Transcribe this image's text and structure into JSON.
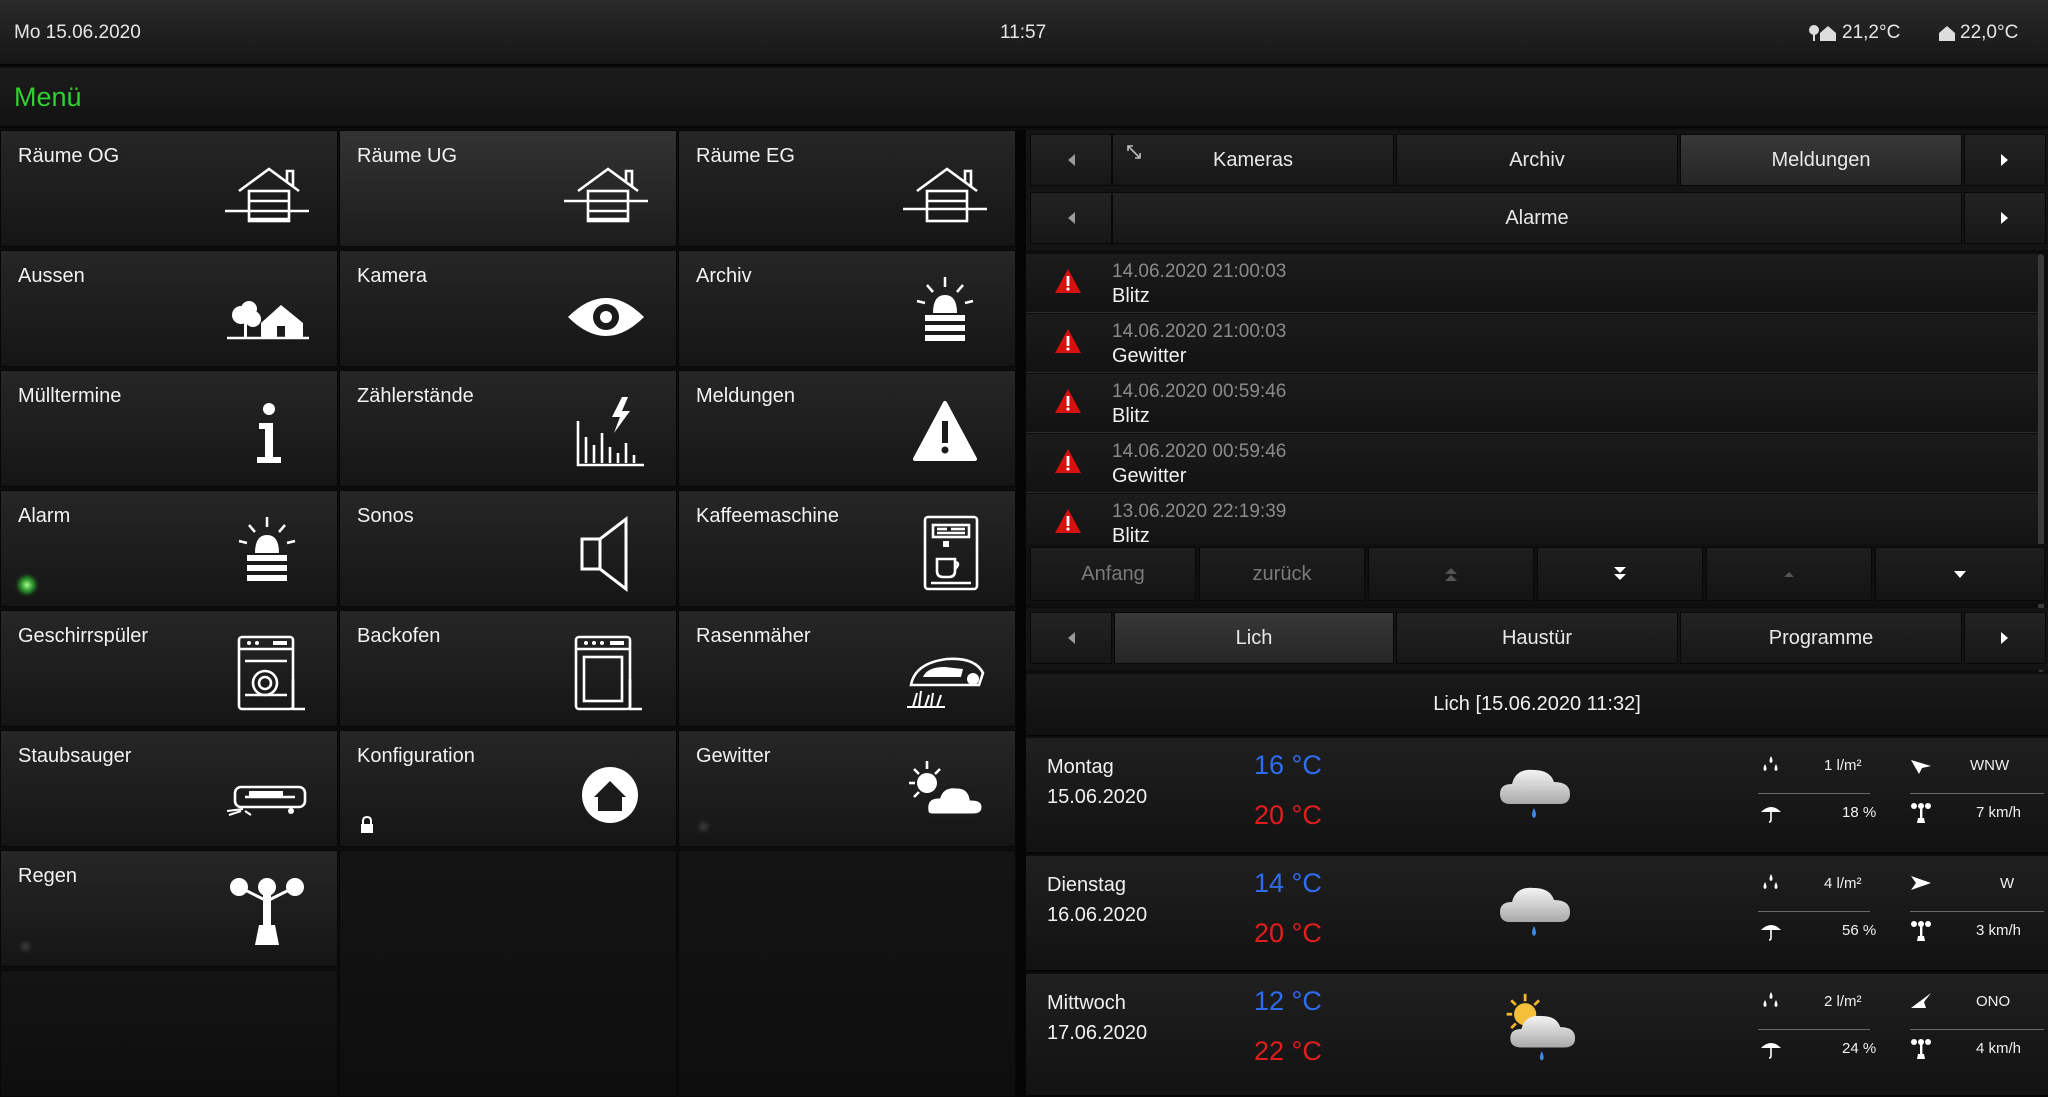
{
  "topbar": {
    "date": "Mo  15.06.2020",
    "time": "11:57",
    "outdoor_temp": "21,2°C",
    "indoor_temp": "22,0°C"
  },
  "menu": {
    "title": "Menü"
  },
  "tiles": [
    {
      "label": "Räume OG",
      "icon": "house-icon"
    },
    {
      "label": "Räume UG",
      "icon": "house-icon"
    },
    {
      "label": "Räume EG",
      "icon": "house-icon"
    },
    {
      "label": "Aussen",
      "icon": "tree-house-icon"
    },
    {
      "label": "Kamera",
      "icon": "eye-icon"
    },
    {
      "label": "Archiv",
      "icon": "siren-icon"
    },
    {
      "label": "Mülltermine",
      "icon": "info-icon"
    },
    {
      "label": "Zählerstände",
      "icon": "meter-chart-icon"
    },
    {
      "label": "Meldungen",
      "icon": "warning-icon"
    },
    {
      "label": "Alarm",
      "icon": "siren-icon"
    },
    {
      "label": "Sonos",
      "icon": "speaker-icon"
    },
    {
      "label": "Kaffeemaschine",
      "icon": "coffee-machine-icon"
    },
    {
      "label": "Geschirrspüler",
      "icon": "dishwasher-icon"
    },
    {
      "label": "Backofen",
      "icon": "oven-icon"
    },
    {
      "label": "Rasenmäher",
      "icon": "lawn-mower-icon"
    },
    {
      "label": "Staubsauger",
      "icon": "vacuum-robot-icon"
    },
    {
      "label": "Konfiguration",
      "icon": "home-circle-icon"
    },
    {
      "label": "Gewitter",
      "icon": "sun-cloud-icon"
    },
    {
      "label": "Regen",
      "icon": "anemometer-icon"
    }
  ],
  "panel": {
    "tabs": [
      "Kameras",
      "Archiv",
      "Meldungen"
    ],
    "subtab": "Alarme",
    "alarms": [
      {
        "datetime": "14.06.2020 21:00:03",
        "text": "Blitz"
      },
      {
        "datetime": "14.06.2020 21:00:03",
        "text": "Gewitter"
      },
      {
        "datetime": "14.06.2020 00:59:46",
        "text": "Blitz"
      },
      {
        "datetime": "14.06.2020 00:59:46",
        "text": "Gewitter"
      },
      {
        "datetime": "13.06.2020 22:19:39",
        "text": "Blitz"
      }
    ],
    "nav": {
      "first": "Anfang",
      "back": "zurück"
    },
    "lower_tabs": [
      "Lich",
      "Haustür",
      "Programme"
    ],
    "forecast_header": "Lich  [15.06.2020 11:32]",
    "forecast": [
      {
        "day": "Montag",
        "date": "15.06.2020",
        "low": "16 °C",
        "high": "20 °C",
        "icon": "rain-cloud-icon",
        "rain": "1 l/m²",
        "wind_dir": "WNW",
        "prob": "18 %",
        "wind": "7 km/h"
      },
      {
        "day": "Dienstag",
        "date": "16.06.2020",
        "low": "14 °C",
        "high": "20 °C",
        "icon": "rain-cloud-icon",
        "rain": "4 l/m²",
        "wind_dir": "W",
        "prob": "56 %",
        "wind": "3 km/h"
      },
      {
        "day": "Mittwoch",
        "date": "17.06.2020",
        "low": "12 °C",
        "high": "22 °C",
        "icon": "sun-rain-cloud-icon",
        "rain": "2 l/m²",
        "wind_dir": "ONO",
        "prob": "24 %",
        "wind": "4 km/h"
      }
    ]
  }
}
